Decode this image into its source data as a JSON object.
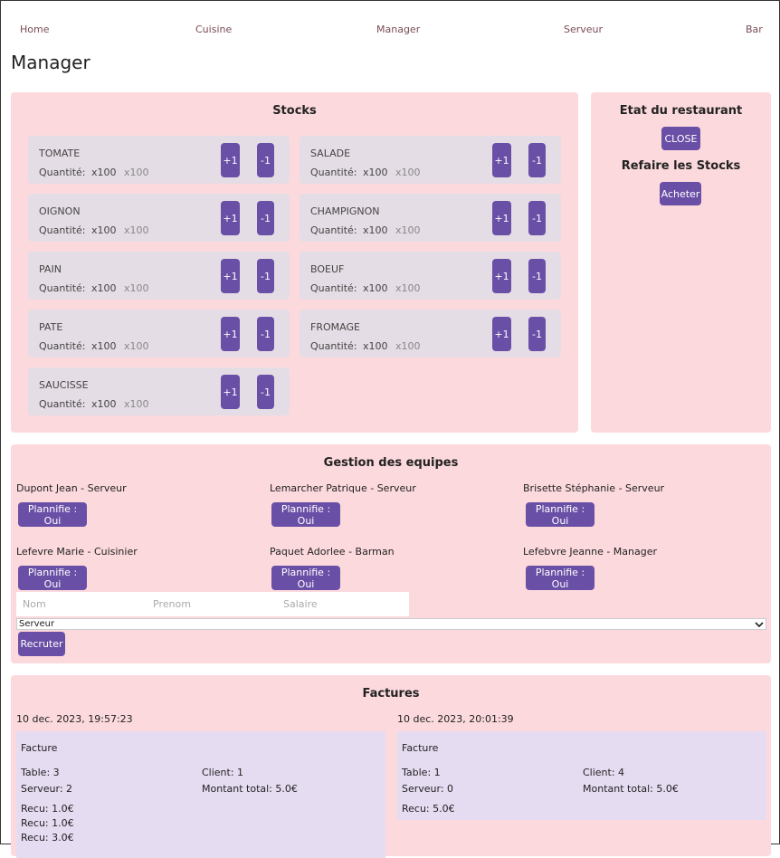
{
  "nav": {
    "home": "Home",
    "cuisine": "Cuisine",
    "manager": "Manager",
    "serveur": "Serveur",
    "bar": "Bar"
  },
  "page_title": "Manager",
  "stocks": {
    "title": "Stocks",
    "qty_label": "Quantité:",
    "plus_label": "+1",
    "minus_label": "-1",
    "items": [
      {
        "name": "TOMATE",
        "qty": "x100",
        "qty2": "x100"
      },
      {
        "name": "SALADE",
        "qty": "x100",
        "qty2": "x100"
      },
      {
        "name": "OIGNON",
        "qty": "x100",
        "qty2": "x100"
      },
      {
        "name": "CHAMPIGNON",
        "qty": "x100",
        "qty2": "x100"
      },
      {
        "name": "PAIN",
        "qty": "x100",
        "qty2": "x100"
      },
      {
        "name": "BOEUF",
        "qty": "x100",
        "qty2": "x100"
      },
      {
        "name": "PATE",
        "qty": "x100",
        "qty2": "x100"
      },
      {
        "name": "FROMAGE",
        "qty": "x100",
        "qty2": "x100"
      },
      {
        "name": "SAUCISSE",
        "qty": "x100",
        "qty2": "x100"
      }
    ]
  },
  "etat": {
    "title": "Etat du restaurant",
    "close_label": "CLOSE",
    "refaire_title": "Refaire les Stocks",
    "acheter_label": "Acheter"
  },
  "equipes": {
    "title": "Gestion des equipes",
    "plannifie_label": "Plannifie : Oui",
    "employees": [
      {
        "name": "Dupont Jean - Serveur"
      },
      {
        "name": "Lemarcher Patrique - Serveur"
      },
      {
        "name": "Brisette Stéphanie - Serveur"
      },
      {
        "name": "Lefevre Marie - Cuisinier"
      },
      {
        "name": "Paquet Adorlee - Barman"
      },
      {
        "name": "Lefebvre Jeanne - Manager"
      }
    ],
    "nom_placeholder": "Nom",
    "prenom_placeholder": "Prenom",
    "salaire_placeholder": "Salaire",
    "role_selected": "Serveur",
    "recruter_label": "Recruter"
  },
  "factures": {
    "title": "Factures",
    "invoices": [
      {
        "date": "10 dec. 2023, 19:57:23",
        "heading": "Facture",
        "table": "Table: 3",
        "client": "Client: 1",
        "serveur": "Serveur: 2",
        "montant": "Montant total: 5.0€",
        "recus": [
          "Recu: 1.0€",
          "Recu: 1.0€",
          "Recu: 3.0€"
        ]
      },
      {
        "date": "10 dec. 2023, 20:01:39",
        "heading": "Facture",
        "table": "Table: 1",
        "client": "Client: 4",
        "serveur": "Serveur: 0",
        "montant": "Montant total: 5.0€",
        "recus": [
          "Recu: 5.0€"
        ]
      }
    ]
  }
}
